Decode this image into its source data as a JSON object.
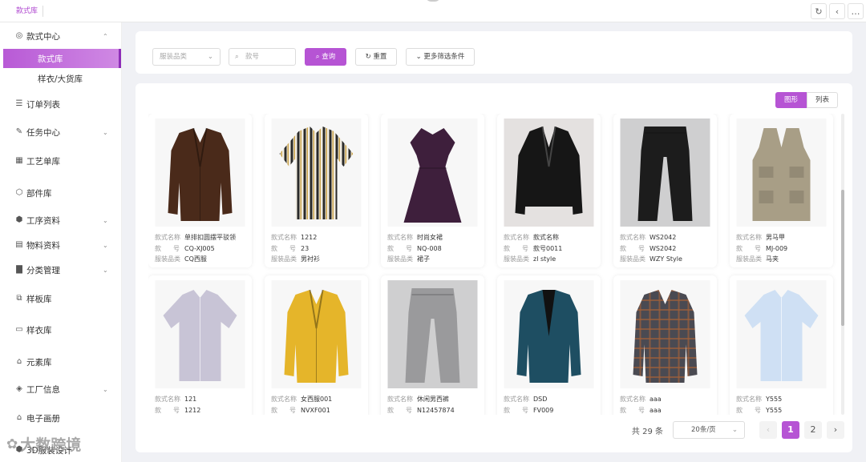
{
  "topbar": {
    "tab": "款式库",
    "icons": [
      "refresh-icon",
      "back-icon",
      "more-icon"
    ]
  },
  "sidebar": {
    "items": [
      {
        "label": "款式中心",
        "icon": "target-icon",
        "expanded": true
      },
      {
        "label": "款式库",
        "active": true
      },
      {
        "label": "样衣/大货库"
      },
      {
        "label": "订单列表",
        "icon": "list-icon"
      },
      {
        "label": "任务中心",
        "icon": "edit-icon"
      },
      {
        "label": "工艺单库",
        "icon": "grid-icon"
      },
      {
        "label": "部件库",
        "icon": "puzzle-icon"
      },
      {
        "label": "工序资料",
        "icon": "cube-icon"
      },
      {
        "label": "物料资料",
        "icon": "doc-icon"
      },
      {
        "label": "分类管理",
        "icon": "bar-icon"
      },
      {
        "label": "样板库",
        "icon": "copy-icon"
      },
      {
        "label": "样衣库",
        "icon": "monitor-icon"
      },
      {
        "label": "元素库",
        "icon": "shirt-icon"
      },
      {
        "label": "工厂信息",
        "icon": "layers-icon"
      },
      {
        "label": "电子画册",
        "icon": "shirt-icon"
      },
      {
        "label": "3D服装设计",
        "icon": "cube-icon"
      }
    ]
  },
  "filters": {
    "category_placeholder": "服装品类",
    "style_no_placeholder": "款号",
    "query_label": "查询",
    "reset_label": "重置",
    "more_label": "更多筛选条件"
  },
  "view_toggle": {
    "grid": "图形",
    "list": "列表",
    "active": "grid"
  },
  "field_labels": {
    "name": "款式名称",
    "no_a": "款",
    "no_b": "号",
    "category": "服装品类"
  },
  "cards": [
    {
      "name": "单排扣圆摆平驳领",
      "no": "CQ-XJ005",
      "category": "CQ西服",
      "garment": "jacket",
      "color": "#4a2a1a"
    },
    {
      "name": "1212",
      "no": "23",
      "category": "男衬衫",
      "garment": "stripe-shirt",
      "color": "#2a2a2a"
    },
    {
      "name": "时尚女裙",
      "no": "NQ-008",
      "category": "裙子",
      "garment": "dress",
      "color": "#3e1f3c"
    },
    {
      "name": "款式名称",
      "no": "款号0011",
      "category": "zl style",
      "garment": "peplum",
      "color": "#161616"
    },
    {
      "name": "WS2042",
      "no": "WS2042",
      "category": "WZY Style",
      "garment": "pants",
      "color": "#1c1c1c"
    },
    {
      "name": "男马甲",
      "no": "MJ-009",
      "category": "马夹",
      "garment": "vest",
      "color": "#a89e86"
    },
    {
      "name": "121",
      "no": "1212",
      "category": "",
      "garment": "shirt",
      "color": "#c8c4d6"
    },
    {
      "name": "女西服001",
      "no": "NVXF001",
      "category": "",
      "garment": "jacket",
      "color": "#e5b52a"
    },
    {
      "name": "休闲男西裤",
      "no": "N12457874",
      "category": "",
      "garment": "pants",
      "color": "#9a9a9c"
    },
    {
      "name": "DSD",
      "no": "FV009",
      "category": "",
      "garment": "tux",
      "color": "#1e4e62"
    },
    {
      "name": "aaa",
      "no": "aaa",
      "category": "",
      "garment": "plaid",
      "color": "#4a4a52"
    },
    {
      "name": "Y555",
      "no": "Y555",
      "category": "",
      "garment": "shirt",
      "color": "#cfe0f4"
    }
  ],
  "pagination": {
    "total": "共 29 条",
    "page_size": "20条/页",
    "pages": [
      "1",
      "2"
    ],
    "current": "1"
  },
  "watermark": "大数跨境"
}
